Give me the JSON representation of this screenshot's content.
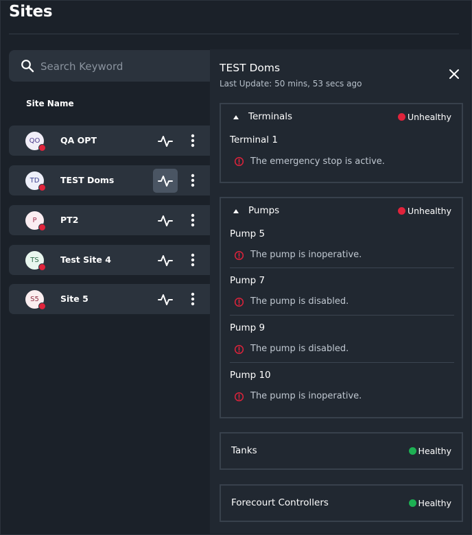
{
  "page": {
    "title": "Sites"
  },
  "search": {
    "placeholder": "Search Keyword",
    "value": ""
  },
  "table": {
    "column_header": "Site Name"
  },
  "sites": [
    {
      "initials": "QO",
      "name": "QA OPT",
      "avatar_bg": "#f1eef8",
      "avatar_fg": "#4b3a8c",
      "status_color": "#e0233b"
    },
    {
      "initials": "TD",
      "name": "TEST Doms",
      "avatar_bg": "#eef0fa",
      "avatar_fg": "#3a3f8c",
      "status_color": "#e0233b",
      "selected": true
    },
    {
      "initials": "P",
      "name": "PT2",
      "avatar_bg": "#fbeef2",
      "avatar_fg": "#a0304e",
      "status_color": "#e0233b"
    },
    {
      "initials": "TS",
      "name": "Test Site 4",
      "avatar_bg": "#e9f7ef",
      "avatar_fg": "#2f6b49",
      "status_color": "#e0233b"
    },
    {
      "initials": "S5",
      "name": "Site 5",
      "avatar_bg": "#fbeef0",
      "avatar_fg": "#8c2a3e",
      "status_color": "#e0233b"
    }
  ],
  "detail": {
    "title": "TEST Doms",
    "last_update": "Last Update: 50 mins, 53 secs ago",
    "sections": {
      "terminals": {
        "title": "Terminals",
        "status": "Unhealthy",
        "status_color": "#e0233b",
        "items": [
          {
            "name": "Terminal 1",
            "alert": "The emergency stop is active."
          }
        ]
      },
      "pumps": {
        "title": "Pumps",
        "status": "Unhealthy",
        "status_color": "#e0233b",
        "items": [
          {
            "name": "Pump 5",
            "alert": "The pump is inoperative."
          },
          {
            "name": "Pump 7",
            "alert": "The pump is disabled."
          },
          {
            "name": "Pump 9",
            "alert": "The pump is disabled."
          },
          {
            "name": "Pump 10",
            "alert": "The pump is inoperative."
          }
        ]
      },
      "tanks": {
        "title": "Tanks",
        "status": "Healthy",
        "status_color": "#1db053"
      },
      "forecourt": {
        "title": "Forecourt Controllers",
        "status": "Healthy",
        "status_color": "#1db053"
      }
    }
  },
  "icons": {
    "search": "search-icon",
    "health": "activity-icon",
    "more": "more-vertical-icon",
    "close": "close-icon",
    "caret": "caret-up-icon",
    "alert": "alert-circle-icon"
  },
  "colors": {
    "background": "#1b2129",
    "row": "#2b333d",
    "panel": "#212831",
    "unhealthy": "#e0233b",
    "healthy": "#1db053"
  }
}
